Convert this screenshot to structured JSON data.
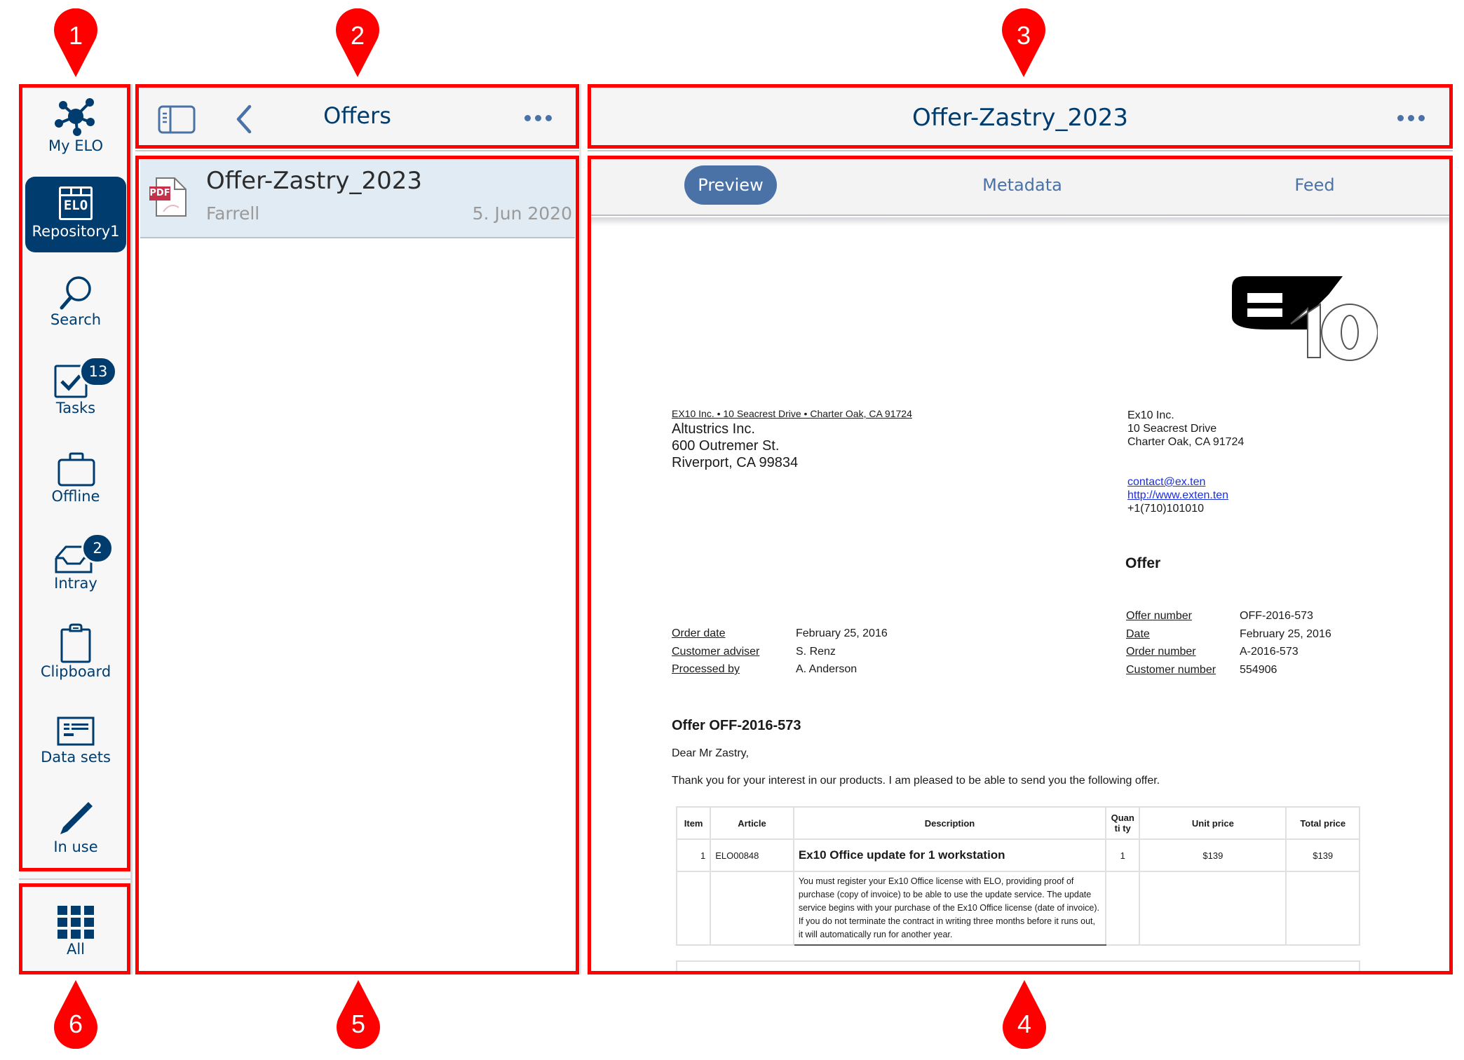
{
  "annotations": {
    "markers": [
      "1",
      "2",
      "3",
      "4",
      "5",
      "6"
    ],
    "color": "#ff0000"
  },
  "sidebar": {
    "items": [
      {
        "label": "My ELO",
        "icon": "network-icon"
      },
      {
        "label": "Repository1",
        "icon": "elo-repository-icon",
        "selected": true
      },
      {
        "label": "Search",
        "icon": "search-icon"
      },
      {
        "label": "Tasks",
        "icon": "tasks-checkbox-icon",
        "badge": "13"
      },
      {
        "label": "Offline",
        "icon": "briefcase-icon"
      },
      {
        "label": "Intray",
        "icon": "inbox-tray-icon",
        "badge": "2"
      },
      {
        "label": "Clipboard",
        "icon": "clipboard-icon"
      },
      {
        "label": "Data sets",
        "icon": "data-sets-icon"
      },
      {
        "label": "In use",
        "icon": "pencil-icon"
      }
    ],
    "all": {
      "label": "All",
      "icon": "grid-icon"
    },
    "repo_icon_text": "ELO"
  },
  "list_panel": {
    "title": "Offers",
    "items": [
      {
        "title": "Offer-Zastry_2023",
        "subtitle": "Farrell",
        "date": "5. Jun 2020",
        "file_type": "PDF"
      }
    ]
  },
  "detail_panel": {
    "title": "Offer-Zastry_2023",
    "tabs": [
      {
        "label": "Preview",
        "active": true
      },
      {
        "label": "Metadata",
        "active": false
      },
      {
        "label": "Feed",
        "active": false
      }
    ]
  },
  "document": {
    "logo_text": "EX10",
    "sender_line": "EX10 Inc. • 10 Seacrest Drive • Charter Oak, CA 91724",
    "recipient": [
      "Altustrics Inc.",
      "600 Outremer St.",
      "Riverport, CA 99834"
    ],
    "company": [
      "Ex10 Inc.",
      "10 Seacrest Drive",
      "Charter Oak, CA 91724"
    ],
    "email": "contact@ex.ten",
    "website": "http://www.exten.ten",
    "phone": "+1(710)101010",
    "doc_type": "Offer",
    "left_fields": [
      {
        "label": "Order date",
        "value": "February 25, 2016"
      },
      {
        "label": "Customer adviser",
        "value": "S. Renz"
      },
      {
        "label": "Processed by",
        "value": "A. Anderson"
      }
    ],
    "right_fields": [
      {
        "label": "Offer number",
        "value": "OFF-2016-573"
      },
      {
        "label": "Date",
        "value": "February 25, 2016"
      },
      {
        "label": "Order number",
        "value": "A-2016-573"
      },
      {
        "label": "Customer number",
        "value": "554906"
      }
    ],
    "heading": "Offer OFF-2016-573",
    "salutation": "Dear Mr Zastry,",
    "intro": "Thank you for your interest in our products. I am pleased to be able to send you the following offer.",
    "table": {
      "headers": [
        "Item",
        "Article",
        "Description",
        "Quanti ty",
        "Unit price",
        "Total price"
      ],
      "rows": [
        {
          "item": "1",
          "article": "ELO00848",
          "description_title": "Ex10 Office update for 1 workstation",
          "description_body": "You must register your Ex10 Office license with ELO, providing proof of purchase (copy of invoice) to be able to use the update service. The update service begins with your purchase of the Ex10 Office license (date of invoice). If you do not terminate the contract in writing three months before it runs out, it will automatically run for another year.",
          "quantity": "1",
          "unit_price": "$139",
          "total_price": "$139"
        }
      ]
    }
  }
}
